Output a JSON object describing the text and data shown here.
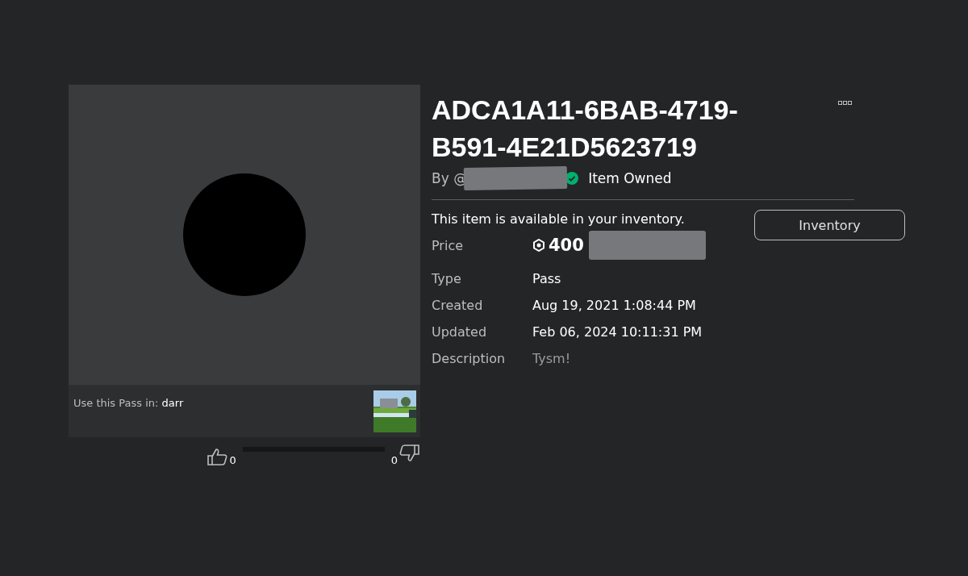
{
  "item": {
    "title": "ADCA1A11-6BAB-4719-B591-4E21D5623719",
    "by_label": "By @",
    "owned_label": "Item Owned",
    "availability": "This item is available in your inventory.",
    "inventory_button": "Inventory",
    "details": [
      {
        "label": "Price",
        "value": "400",
        "kind": "price"
      },
      {
        "label": "Type",
        "value": "Pass",
        "kind": "text"
      },
      {
        "label": "Created",
        "value": "Aug 19, 2021 1:08:44 PM",
        "kind": "text"
      },
      {
        "label": "Updated",
        "value": "Feb 06, 2024 10:11:31 PM",
        "kind": "text"
      },
      {
        "label": "Description",
        "value": "Tysm!",
        "kind": "description"
      }
    ]
  },
  "usage": {
    "label": "Use this Pass in:",
    "game": "darr"
  },
  "votes": {
    "up": "0",
    "down": "0"
  }
}
